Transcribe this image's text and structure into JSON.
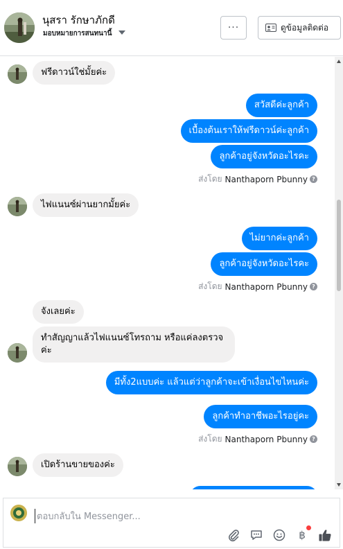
{
  "header": {
    "contact_name": "นุสรา รักษาภักดี",
    "contact_subtitle": "มอบหมายการสนทนานี้",
    "more_label": "···",
    "contact_info_label": "ดูข้อมูลติดต่อ"
  },
  "messages": [
    {
      "direction": "in",
      "text": "ฟรีดาวน์ใช่มั้ยค่ะ"
    },
    {
      "direction": "out",
      "text": "สวัสดีค่ะลูกค้า"
    },
    {
      "direction": "out",
      "text": "เบื้องต้นเราให้ฟรีดาวน์ค่ะลูกค้า"
    },
    {
      "direction": "out",
      "text": "ลูกค้าอยู่จังหวัดอะไรคะ"
    },
    {
      "direction": "in",
      "text": "ไฟแนนซ์ผ่านยากมั้ยค่ะ"
    },
    {
      "direction": "out",
      "text": "ไม่ยากค่ะลูกค้า"
    },
    {
      "direction": "out",
      "text": "ลูกค้าอยู่จังหวัดอะไรคะ"
    },
    {
      "direction": "in",
      "text": "จังเลยค่ะ"
    },
    {
      "direction": "in",
      "text": "ทำสัญญาแล้วไฟแนนซ์โทรถาม หรือแค่ลงตรวจค่ะ"
    },
    {
      "direction": "out",
      "text": "มีทั้ง2แบบค่ะ แล้วแต่ว่าลูกค้าจะเข้าเงื่อนไขไหนค่ะ"
    },
    {
      "direction": "out",
      "text": "ลูกค้าทำอาชีพอะไรอยู่คะ"
    },
    {
      "direction": "in",
      "text": "เปิดร้านขายของค่ะ"
    }
  ],
  "sent_by": {
    "prefix": "ส่งโดย",
    "sender": "Nanthaporn Pbunny",
    "help_icon": "?"
  },
  "composer": {
    "placeholder": "ตอบกลับใน Messenger...",
    "icons": [
      "attach-icon",
      "chat-icon",
      "emoji-icon",
      "baht-icon",
      "like-icon"
    ],
    "baht_symbol": "฿"
  },
  "colors": {
    "outgoing_bubble": "#0084ff",
    "incoming_bubble": "#f1f0f0",
    "notification_dot": "#fa3e3e"
  }
}
